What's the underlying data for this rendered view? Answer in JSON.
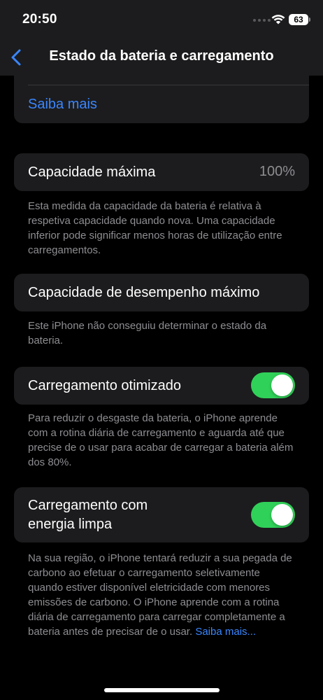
{
  "status_bar": {
    "time": "20:50",
    "battery_level": "63",
    "wifi_icon": "wifi-icon",
    "signal_icon": "cellular-signal-icon"
  },
  "nav": {
    "back_icon": "chevron-left-icon",
    "title": "Estado da bateria e carregamento"
  },
  "top_section": {
    "link_label": "Saiba mais"
  },
  "max_capacity": {
    "label": "Capacidade máxima",
    "value": "100%",
    "footer": "Esta medida da capacidade da bateria é relativa à respetiva capacidade quando nova. Uma capacidade inferior pode significar menos horas de utilização entre carregamentos."
  },
  "peak_performance": {
    "label": "Capacidade de desempenho máximo",
    "footer": "Este iPhone não conseguiu determinar o estado da bateria."
  },
  "optimized_charging": {
    "label": "Carregamento otimizado",
    "enabled": true,
    "footer": "Para reduzir o desgaste da bateria, o iPhone aprende com a rotina diária de carregamento e aguarda até que precise de o usar para acabar de carregar a bateria além dos 80%."
  },
  "clean_energy_charging": {
    "label_line1": "Carregamento com",
    "label_line2": "energia limpa",
    "enabled": true,
    "footer": "Na sua região, o iPhone tentará reduzir a sua pegada de carbono ao efetuar o carregamento seletivamente quando estiver disponível eletricidade com menores emissões de carbono. O iPhone aprende com a rotina diária de carregamento para carregar completamente a bateria antes de precisar de o usar.",
    "footer_link": "Saiba mais..."
  },
  "colors": {
    "accent": "#3a86ff",
    "toggle_on": "#30d158",
    "card_bg": "#1c1c1e",
    "secondary_text": "#8e8e93"
  }
}
